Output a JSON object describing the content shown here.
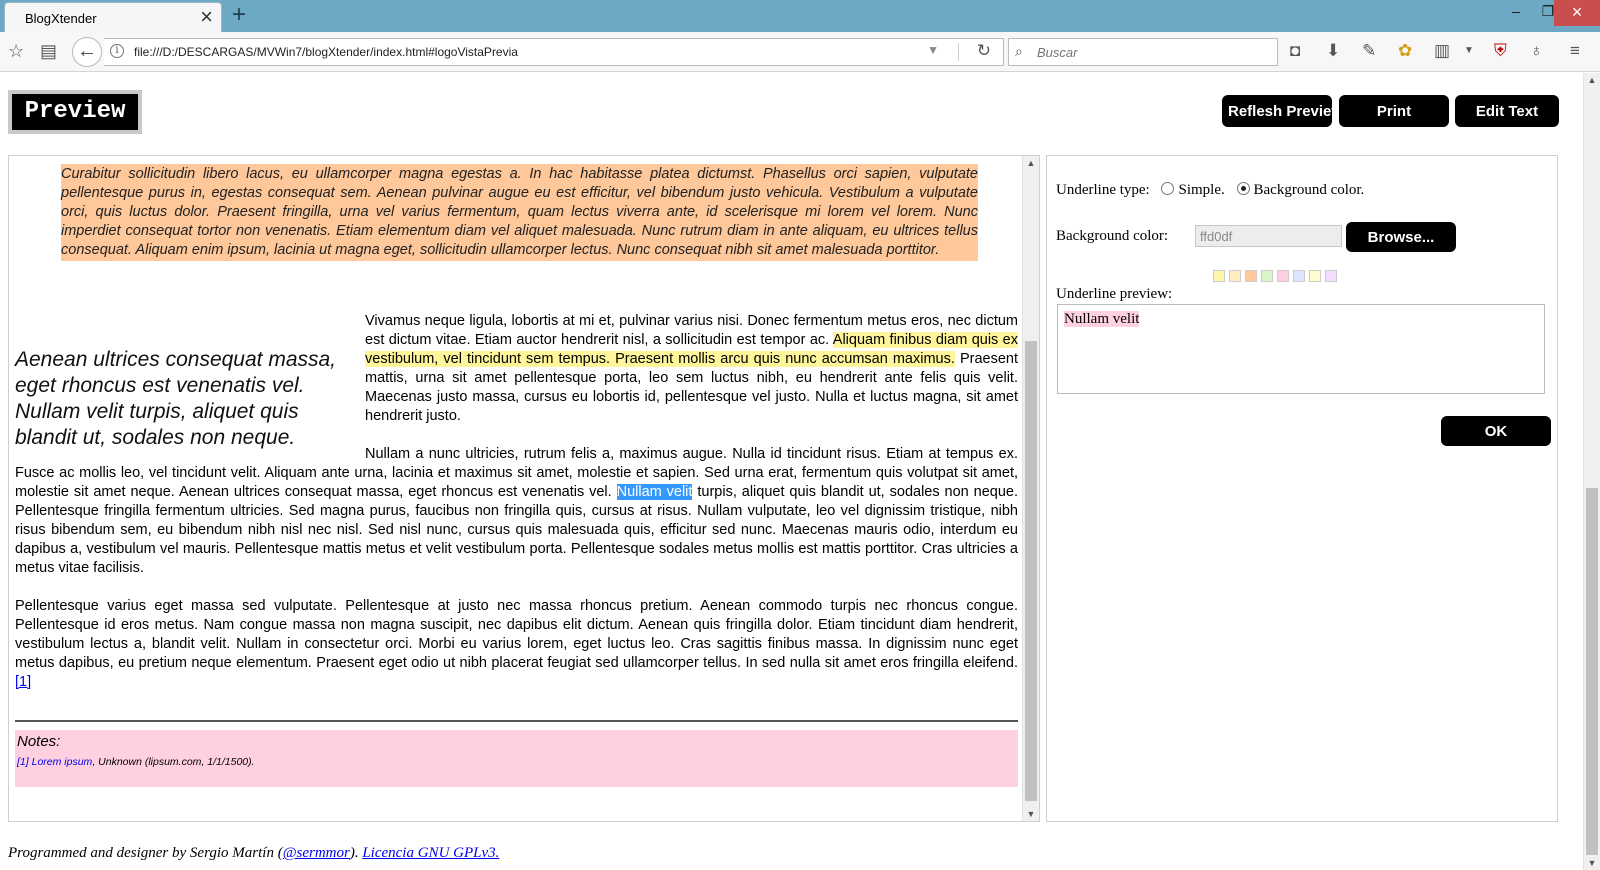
{
  "browser": {
    "tab_title": "BlogXtender",
    "url": "file:///D:/DESCARGAS/MVWin7/blogXtender/index.html#logoVistaPrevia",
    "search_placeholder": "Buscar"
  },
  "header": {
    "logo": "Preview",
    "refresh_label": "Reflesh Preview",
    "print_label": "Print",
    "edit_label": "Edit Text"
  },
  "preview": {
    "quote": "Curabitur sollicitudin libero lacus, eu ullamcorper magna egestas a. In hac habitasse platea dictumst. Phasellus orci sapien, vulputate pellentesque purus in, egestas consequat sem. Aenean pulvinar augue eu est efficitur, vel bibendum justo vehicula. Vestibulum a vulputate orci, quis luctus dolor. Praesent fringilla, urna vel varius fermentum, quam lectus viverra ante, id scelerisque mi lorem vel lorem. Nunc imperdiet consequat tortor non venenatis. Etiam elementum diam vel aliquet malesuada. Nunc rutrum diam in ante aliquam, eu ultrices tellus consequat. Aliquam enim ipsum, lacinia ut magna eget, sollicitudin ullamcorper lectus. Nunc consequat nibh sit amet malesuada porttitor.",
    "pullquote": "Aenean ultrices consequat massa, eget rhoncus est venenatis vel. Nullam velit turpis, aliquet quis blandit ut, sodales non neque.",
    "p1_a": "Vivamus neque ligula, lobortis at mi et, pulvinar varius nisi. Donec fermentum metus eros, nec dictum est dictum vitae. Etiam auctor hendrerit nisl, a sollicitudin est tempor ac. ",
    "p1_hl": "Aliquam finibus diam quis ex vestibulum, vel tincidunt sem tempus. Praesent mollis arcu quis nunc accumsan maximus.",
    "p1_b": " Praesent mattis, urna sit amet pellentesque porta, leo sem luctus nibh, eu hendrerit ante felis quis velit. Maecenas justo massa, cursus eu lobortis id, pellentesque vel justo. Nulla et luctus magna, sit amet hendrerit justo.",
    "p2_a": "Nullam a nunc ultricies, rutrum felis a, maximus augue. Nulla id tincidunt risus. Etiam at tempus ex. Fusce ac mollis leo, vel tincidunt velit. Aliquam ante urna, lacinia et maximus sit amet, molestie et sapien. Sed urna erat, fermentum quis volutpat sit amet, molestie sit amet neque. Aenean ultrices consequat massa, eget rhoncus est venenatis vel. ",
    "p2_sel": "Nullam velit",
    "p2_b": " turpis, aliquet quis blandit ut, sodales non neque. Pellentesque fringilla fermentum ultricies. Sed magna purus, faucibus non fringilla quis, cursus at risus. Nullam vulputate, leo vel dignissim tristique, nibh risus bibendum sem, eu bibendum nibh nisl nec nisl. Sed nisl nunc, cursus quis malesuada quis, efficitur sed nunc. Maecenas mauris odio, interdum eu dapibus a, vestibulum vel mauris. Pellentesque mattis metus et velit vestibulum porta. Pellentesque sodales metus mollis est mattis porttitor. Cras ultricies a metus vitae facilisis.",
    "p3": "Pellentesque varius eget massa sed vulputate. Pellentesque at justo nec massa rhoncus pretium. Aenean commodo turpis nec rhoncus congue. Pellentesque id eros metus. Nam congue massa non magna suscipit, nec dapibus elit dictum. Aenean quis fringilla dolor. Etiam tincidunt diam hendrerit, vestibulum lectus a, blandit velit. Nullam in consectetur orci. Morbi eu varius lorem, eget luctus leo. Cras sagittis finibus massa. In dignissim nunc eget metus dapibus, eu pretium neque elementum. Praesent eget odio ut nibh placerat feugiat sed ullamcorper tellus. In sed nulla sit amet eros fringilla eleifend.",
    "p3_ref": "[1]",
    "notes_title": "Notes:",
    "note_num": "[1]",
    "note_link": "Lorem ipsum",
    "note_rest": ", Unknown (lipsum.com, 1/1/1500)."
  },
  "options": {
    "underline_type_label": "Underline type:",
    "simple_label": "Simple.",
    "bg_option_label": "Background color.",
    "selected_type": "background",
    "bg_color_label": "Background color:",
    "bg_color_value": "ffd0df",
    "browse_label": "Browse...",
    "swatches": [
      "#fff6a8",
      "#ffeec0",
      "#ffc89a",
      "#d8f5c8",
      "#ffd0df",
      "#dde6ff",
      "#fffbd0",
      "#f3dcff"
    ],
    "preview_label": "Underline preview:",
    "preview_text": "Nullam velit",
    "ok_label": "OK"
  },
  "footer": {
    "text_a": "Programmed and designer by Sergio Martín (",
    "handle": "@sermmor",
    "text_b": "). ",
    "license": "Licencia GNU GPLv3."
  }
}
